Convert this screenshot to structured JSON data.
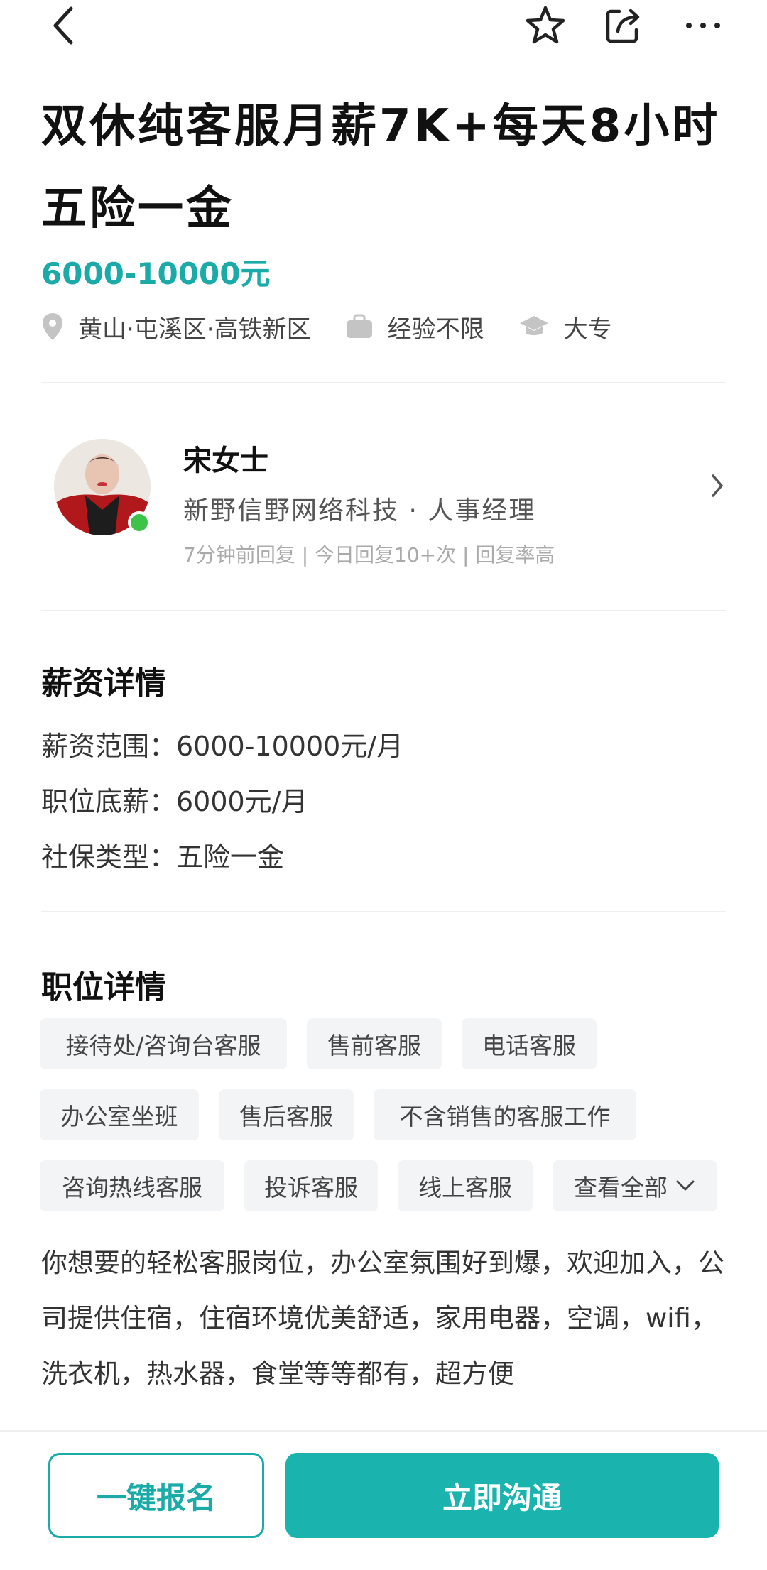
{
  "header": {
    "back_icon": "chevron-left-icon",
    "favorite_icon": "star-icon",
    "share_icon": "share-icon",
    "more_icon": "more-icon"
  },
  "job": {
    "title": "双休纯客服月薪7K+每天8小时五险一金",
    "salary": "6000-10000元",
    "location": "黄山·屯溪区·高铁新区",
    "experience": "经验不限",
    "education": "大专"
  },
  "recruiter": {
    "name": "宋女士",
    "company_role": "新野信野网络科技 · 人事经理",
    "status": "7分钟前回复 | 今日回复10+次 | 回复率高"
  },
  "salary_details": {
    "title": "薪资详情",
    "range": "薪资范围：6000-10000元/月",
    "base": "职位底薪：6000元/月",
    "insurance": "社保类型：五险一金"
  },
  "position_details": {
    "title": "职位详情",
    "tags": [
      "接待处/咨询台客服",
      "售前客服",
      "电话客服",
      "办公室坐班",
      "售后客服",
      "不含销售的客服工作",
      "咨询热线客服",
      "投诉客服",
      "线上客服",
      "查看全部"
    ],
    "description": "你想要的轻松客服岗位，办公室氛围好到爆，欢迎加入，公司提供住宿，住宿环境优美舒适，家用电器，空调，wifi，洗衣机，热水器，食堂等等都有，超方便"
  },
  "actions": {
    "signup": "一键报名",
    "chat": "立即沟通"
  },
  "colors": {
    "accent": "#1aaba8",
    "online": "#3dc24a"
  }
}
